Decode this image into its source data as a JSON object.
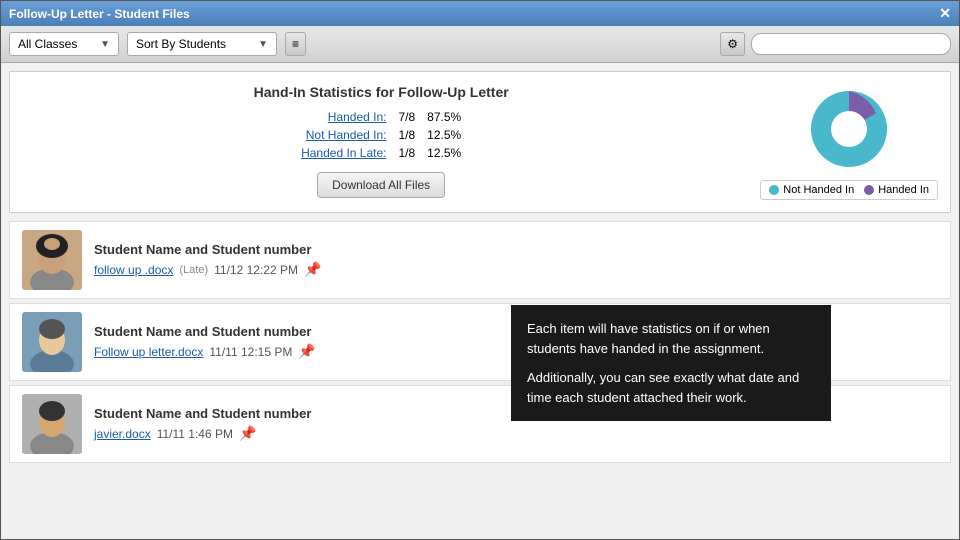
{
  "window": {
    "title": "Follow-Up Letter - Student Files",
    "close_label": "✕"
  },
  "toolbar": {
    "class_dropdown": "All Classes",
    "sort_dropdown": "Sort By Students",
    "settings_icon": "⚙",
    "search_placeholder": ""
  },
  "stats": {
    "title": "Hand-In Statistics for Follow-Up Letter",
    "rows": [
      {
        "label": "Handed In:",
        "fraction": "7/8",
        "percent": "87.5%"
      },
      {
        "label": "Not Handed In:",
        "fraction": "1/8",
        "percent": "12.5%"
      },
      {
        "label": "Handed In Late:",
        "fraction": "1/8",
        "percent": "12.5%"
      }
    ],
    "download_btn": "Download All Files",
    "pie": {
      "handed_in_color": "#4ab8cc",
      "not_handed_in_color": "#7b5ea7",
      "handed_in_pct": 87.5,
      "not_handed_in_pct": 12.5
    },
    "legend": {
      "not_handed_in_label": "Not Handed In",
      "handed_in_label": "Handed In"
    }
  },
  "students": [
    {
      "name": "Student Name and Student number",
      "file": "follow up .docx",
      "late": "(Late)",
      "date": "11/12 12:22 PM",
      "avatar_style": "female"
    },
    {
      "name": "Student Name and Student number",
      "file": "Follow up letter.docx",
      "late": "",
      "date": "11/11 12:15 PM",
      "avatar_style": "male1"
    },
    {
      "name": "Student Name and Student number",
      "file": "javier.docx",
      "late": "",
      "date": "11/11 1:46 PM",
      "avatar_style": "male2"
    }
  ],
  "tooltip": {
    "line1": "Each item will have statistics on if or when students have handed in the assignment.",
    "line2": "Additionally, you can see exactly what date and time each student attached their work."
  }
}
